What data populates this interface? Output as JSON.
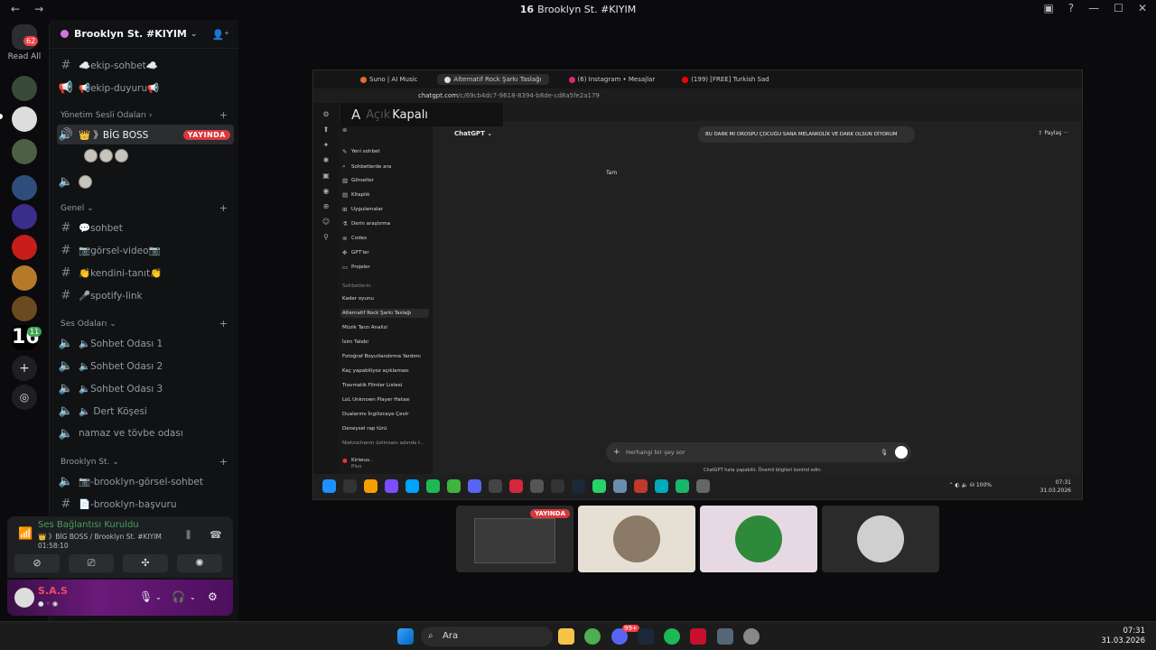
{
  "window": {
    "title": "Brooklyn St. #KIYIM",
    "title_badge": "16"
  },
  "rail": {
    "read_all": "Read All",
    "dm_badge": "62",
    "server_badge": "11"
  },
  "server": {
    "name": "Brooklyn St. #KIYIM"
  },
  "channels": {
    "top": [
      {
        "label": "☁️ekip-sohbet☁️"
      },
      {
        "label": "📢ekip-duyuru📢"
      }
    ],
    "cat_yonetim": "Yönetim Sesli Odaları",
    "big_boss": "👑 》BİG BOSS",
    "live_label": "YAYINDA",
    "cat_genel": "Genel",
    "genel": [
      {
        "label": "💬sohbet"
      },
      {
        "label": "📷görsel-video📷"
      },
      {
        "label": "👏kendini-tanıt👏"
      },
      {
        "label": "🎤spotify-link"
      }
    ],
    "cat_ses": "Ses Odaları",
    "ses": [
      {
        "label": "🔈Sohbet Odası 1"
      },
      {
        "label": "🔈Sohbet Odası 2"
      },
      {
        "label": "🔈Sohbet Odası 3"
      },
      {
        "label": "🔈 Dert Köşesi"
      },
      {
        "label": "namaz ve tövbe odası"
      }
    ],
    "cat_brooklyn": "Brooklyn St.",
    "brooklyn": [
      {
        "label": "📷-brooklyn-görsel-sohbet"
      },
      {
        "label": "📄-brooklyn-başvuru"
      }
    ]
  },
  "voice": {
    "status": "Ses Bağlantısı Kuruldu",
    "channel": "👑 》BİG BOSS / Brooklyn St. #KIYIM",
    "timer": "01:58:10"
  },
  "user": {
    "name": "S.A.S"
  },
  "stream": {
    "tabs": [
      "Suno | AI Music",
      "Alternatif Rock Şarkı Taslağı",
      "(6) Instagram • Mesajlar",
      "(199) [FREE] Turkish Sad"
    ],
    "url_host": "chatgpt.com",
    "url_path": "/c/69cb4dc7-9618-8394-b8de-cd8a5fe2a179",
    "overlay_key": "A",
    "overlay_off": "Açık",
    "overlay_on": "Kapalı",
    "sidebar_items": [
      "Yeni sohbet",
      "Sohbetlerde ara",
      "Görseller",
      "Kitaplık",
      "Uygulamalar",
      "Derin araştırma",
      "Codex",
      "GPT'ler",
      "Projeler"
    ],
    "chats_label": "Sohbetlerin",
    "chats": [
      "Kader oyunu",
      "Alternatif Rock Şarkı Taslağı",
      "Müzik Tarzı Analizi",
      "İsim Talebi",
      "Fotoğraf Boyutlandırma Yardımı",
      "Kaç yapabiliyoz açıklaması",
      "Travmatik Filmler Listesi",
      "LoL Unknown Player Hatası",
      "Dualarımı İngilizceye Çevir",
      "Deneysel rap türü",
      "Nietzschenin üstinsanı adında t..."
    ],
    "account_name": "Kiriwuu .",
    "account_plan": "Plus",
    "model": "ChatGPT",
    "share": "Paylaş",
    "user_message": "BU DARK MI OROSPU ÇOCUĞU SANA MELANKOLİK VE DARK OLSUN DİYORUM",
    "response": "Tam",
    "composer_placeholder": "Herhangi bir şey sor",
    "disclaimer": "ChatGPT hata yapabilir. Önemli bilgileri kontrol edin.",
    "battery": "100%",
    "time": "07:31",
    "date": "31.03.2026"
  },
  "tiles": {
    "live_label": "YAYINDA"
  },
  "taskbar": {
    "search_label": "Ara",
    "time": "07:31",
    "date": "31.03.2026",
    "discord_badge": "99+"
  },
  "colors": {
    "live": "#da373c",
    "connected": "#43a25a",
    "accent": "#5865f2"
  }
}
